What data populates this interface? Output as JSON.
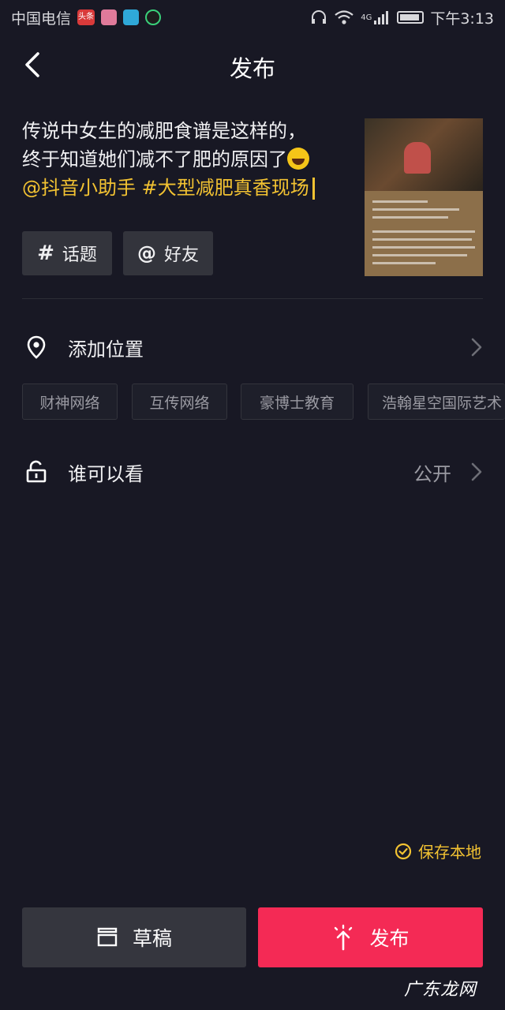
{
  "status_bar": {
    "carrier": "中国电信",
    "news_app_badge": "头条",
    "network": "4G",
    "time": "下午3:13"
  },
  "header": {
    "title": "发布"
  },
  "caption": {
    "line1": "传说中女生的减肥食谱是这样的，",
    "line2": "终于知道她们减不了肥的原因了",
    "tags": "@抖音小助手 #大型减肥真香现场"
  },
  "chips": {
    "topic_label": "话题",
    "topic_symbol": "#",
    "friend_label": "好友",
    "friend_symbol": "@"
  },
  "location": {
    "label": "添加位置",
    "suggestions": [
      "财神网络",
      "互传网络",
      "豪博士教育",
      "浩翰星空国际艺术"
    ]
  },
  "visibility": {
    "label": "谁可以看",
    "value": "公开"
  },
  "save_local": {
    "label": "保存本地"
  },
  "actions": {
    "draft_label": "草稿",
    "publish_label": "发布"
  },
  "watermark": "广东龙网",
  "colors": {
    "background": "#181824",
    "accent_yellow": "#f2c232",
    "publish_red": "#f42a55",
    "chip_bg": "#33343c"
  }
}
